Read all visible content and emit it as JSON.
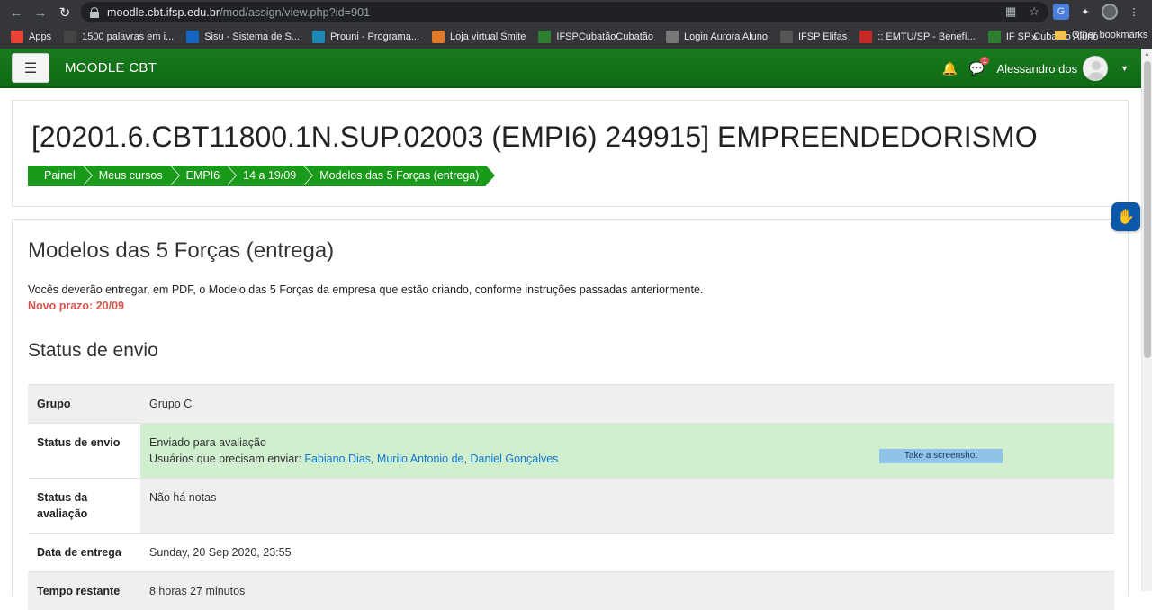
{
  "browser": {
    "url_host": "moodle.cbt.ifsp.edu.br",
    "url_path": "/mod/assign/view.php?id=901",
    "bookmarks": [
      {
        "label": "Apps",
        "color": "#ea4335"
      },
      {
        "label": "1500 palavras em i...",
        "color": "#444444"
      },
      {
        "label": "Sisu - Sistema de S...",
        "color": "#1565c0"
      },
      {
        "label": "Prouni - Programa...",
        "color": "#1e88b4"
      },
      {
        "label": "Loja virtual Smite",
        "color": "#e07b2a"
      },
      {
        "label": "IFSPCubatãoCubatão",
        "color": "#2e7d32"
      },
      {
        "label": "Login Aurora Aluno",
        "color": "#777777"
      },
      {
        "label": "IFSP Elifas",
        "color": "#555555"
      },
      {
        "label": ":: EMTU/SP - Benefí...",
        "color": "#c62828"
      },
      {
        "label": "IF SP Cubatao Aluno",
        "color": "#2e7d32"
      }
    ],
    "bookmarks_more": "»",
    "other_bookmarks": "Other bookmarks"
  },
  "navbar": {
    "brand": "MOODLE CBT",
    "notification_count": "1",
    "user_name": "Alessandro dos"
  },
  "header": {
    "course_title": "[20201.6.CBT11800.1N.SUP.02003 (EMPI6) 249915] EMPREENDEDORISMO",
    "breadcrumb": [
      "Painel",
      "Meus cursos",
      "EMPI6",
      "14 a 19/09",
      "Modelos das 5 Forças (entrega)"
    ]
  },
  "assignment": {
    "title": "Modelos das 5 Forças (entrega)",
    "description": "Vocês deverão entregar, em PDF, o Modelo das 5 Forças da empresa que estão criando, conforme instruções passadas anteriormente.",
    "deadline_note": "Novo prazo: 20/09",
    "status_section_title": "Status de envio"
  },
  "status_table": {
    "group_label": "Grupo",
    "group_value": "Grupo C",
    "submission_label": "Status de envio",
    "submission_value": "Enviado para avaliação",
    "pending_users_prefix": "Usuários que precisam enviar:",
    "pending_users": [
      "Fabiano Dias",
      "Murilo Antonio de",
      "Daniel Gonçalves"
    ],
    "grading_label": "Status da avaliação",
    "grading_value": "Não há notas",
    "due_label": "Data de entrega",
    "due_value": "Sunday, 20 Sep 2020, 23:55",
    "remaining_label": "Tempo restante",
    "remaining_value": "8 horas 27 minutos"
  },
  "screenshot_button": "Take a screenshot",
  "colors": {
    "navbar_green": "#187a1e",
    "breadcrumb_green": "#1a9a1a",
    "submitted_bg": "#cfefcf",
    "deadline_red": "#d9534f",
    "link_blue": "#1177d1"
  }
}
